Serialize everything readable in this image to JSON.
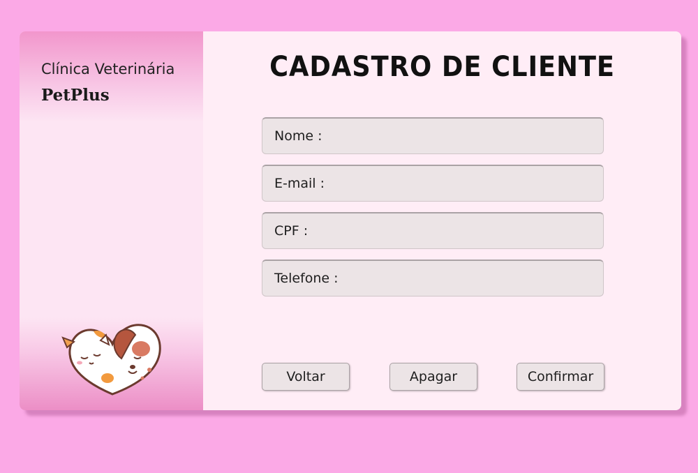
{
  "sidebar": {
    "clinic_label": "Clínica Veterinária",
    "brand_name": "PetPlus",
    "mascot_icon": "cat-and-dog-heart-icon"
  },
  "main": {
    "title": "CADASTRO DE CLIENTE",
    "fields": [
      {
        "label": "Nome :",
        "value": ""
      },
      {
        "label": "E-mail :",
        "value": ""
      },
      {
        "label": "CPF :",
        "value": ""
      },
      {
        "label": "Telefone :",
        "value": ""
      }
    ],
    "buttons": {
      "back": "Voltar",
      "clear": "Apagar",
      "confirm": "Confirmar"
    }
  },
  "colors": {
    "background": "#fba9e6",
    "card": "#ffedf6",
    "sidebar_accent": "#ec8ec6",
    "field_bg": "#ece4e6"
  }
}
